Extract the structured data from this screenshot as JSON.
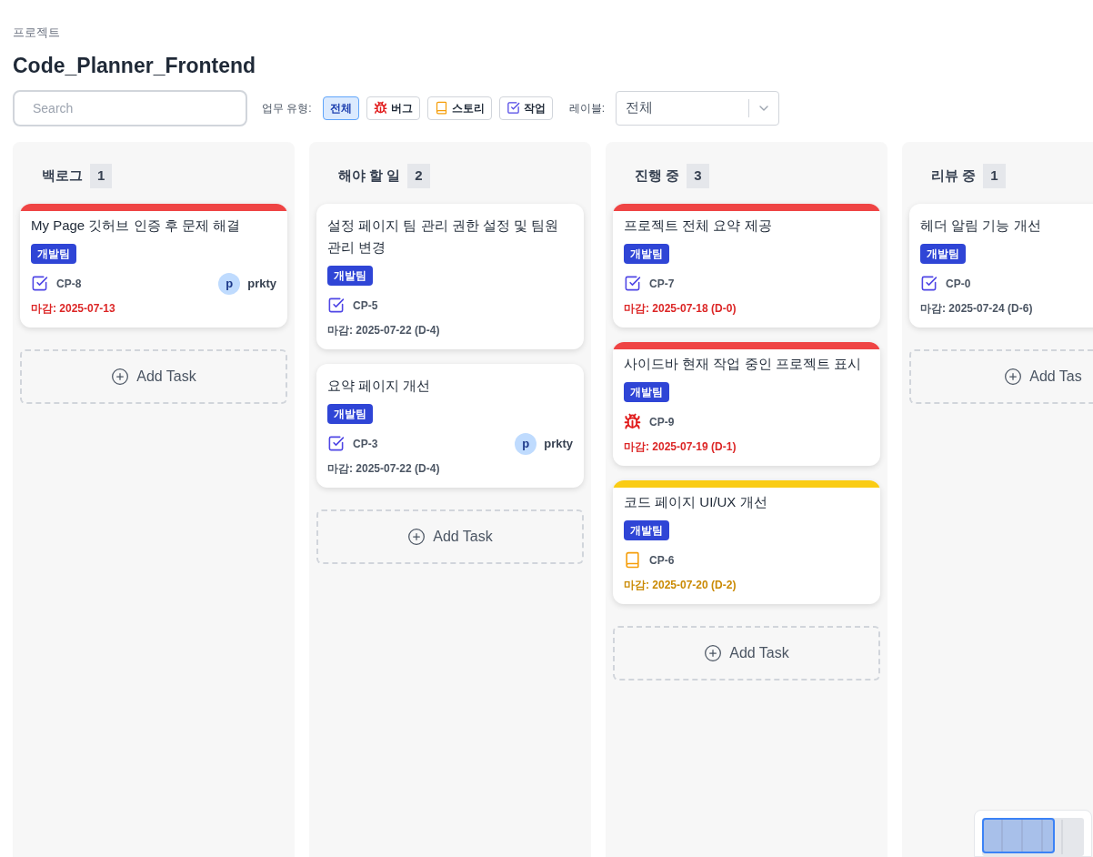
{
  "header": {
    "label": "프로젝트",
    "title": "Code_Planner_Frontend"
  },
  "toolbar": {
    "search": {
      "placeholder": "Search"
    },
    "type_label": "업무 유형:",
    "type_filters": [
      {
        "kind": "all",
        "label": "전체",
        "selected": true
      },
      {
        "kind": "bug",
        "label": "버그",
        "selected": false
      },
      {
        "kind": "story",
        "label": "스토리",
        "selected": false
      },
      {
        "kind": "task",
        "label": "작업",
        "selected": false
      }
    ],
    "label_filter": {
      "label": "레이블:",
      "value": "전체"
    }
  },
  "columns": [
    {
      "title": "백로그",
      "count": "1",
      "add_label": "Add Task",
      "cards": [
        {
          "title": "My Page 깃허브 인증 후 문제 해결",
          "color": "#ef4444",
          "tag": "개발팀",
          "kind": "task",
          "key": "CP-8",
          "assignee": {
            "initial": "p",
            "name": "prkty"
          },
          "due": "마감: 2025-07-13",
          "urgent": true,
          "warning": false
        }
      ]
    },
    {
      "title": "해야 할 일",
      "count": "2",
      "add_label": "Add Task",
      "cards": [
        {
          "title": "설정 페이지 팀 관리 권한 설정 및 팀원 관리 변경",
          "tag": "개발팀",
          "kind": "task",
          "key": "CP-5",
          "due": "마감: 2025-07-22 (D-4)",
          "urgent": false,
          "warning": false
        },
        {
          "title": "요약 페이지 개선",
          "tag": "개발팀",
          "kind": "task",
          "key": "CP-3",
          "assignee": {
            "initial": "p",
            "name": "prkty"
          },
          "due": "마감: 2025-07-22 (D-4)",
          "urgent": false,
          "warning": false
        }
      ]
    },
    {
      "title": "진행 중",
      "count": "3",
      "add_label": "Add Task",
      "cards": [
        {
          "title": "프로젝트 전체 요약 제공",
          "color": "#ef4444",
          "tag": "개발팀",
          "kind": "task",
          "key": "CP-7",
          "due": "마감: 2025-07-18 (D-0)",
          "urgent": true,
          "warning": false
        },
        {
          "title": "사이드바 현재 작업 중인 프로젝트 표시",
          "color": "#ef4444",
          "tag": "개발팀",
          "kind": "bug",
          "key": "CP-9",
          "due": "마감: 2025-07-19 (D-1)",
          "urgent": true,
          "warning": false
        },
        {
          "title": "코드 페이지 UI/UX 개선",
          "color": "#facc15",
          "tag": "개발팀",
          "kind": "story",
          "key": "CP-6",
          "due": "마감: 2025-07-20 (D-2)",
          "urgent": false,
          "warning": true
        }
      ]
    },
    {
      "title": "리뷰 중",
      "count": "1",
      "add_label": "Add Tas",
      "cards": [
        {
          "title": "헤더 알림 기능 개선",
          "tag": "개발팀",
          "kind": "task",
          "key": "CP-0",
          "due": "마감: 2025-07-24 (D-6)",
          "urgent": false,
          "warning": false
        }
      ]
    }
  ]
}
